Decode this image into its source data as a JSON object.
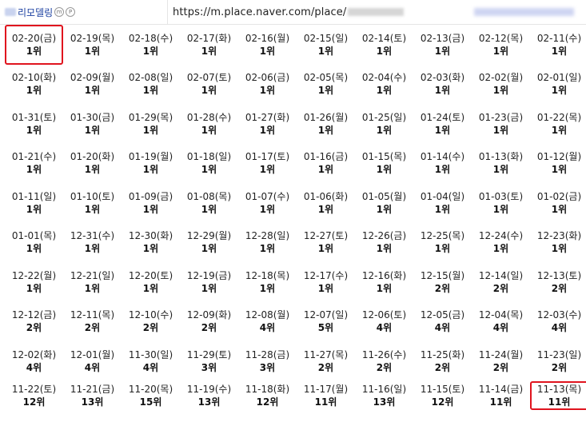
{
  "header": {
    "place_name": "리모델링",
    "place_suffix_icon": "mp-icon",
    "url": "https://m.place.naver.com/place/"
  },
  "highlight_color": "#e0141e",
  "cells": [
    {
      "date": "02-20(금)",
      "rank": "1위",
      "highlight": true
    },
    {
      "date": "02-19(목)",
      "rank": "1위"
    },
    {
      "date": "02-18(수)",
      "rank": "1위"
    },
    {
      "date": "02-17(화)",
      "rank": "1위"
    },
    {
      "date": "02-16(월)",
      "rank": "1위"
    },
    {
      "date": "02-15(일)",
      "rank": "1위"
    },
    {
      "date": "02-14(토)",
      "rank": "1위"
    },
    {
      "date": "02-13(금)",
      "rank": "1위"
    },
    {
      "date": "02-12(목)",
      "rank": "1위"
    },
    {
      "date": "02-11(수)",
      "rank": "1위"
    },
    {
      "date": "02-10(화)",
      "rank": "1위"
    },
    {
      "date": "02-09(월)",
      "rank": "1위"
    },
    {
      "date": "02-08(일)",
      "rank": "1위"
    },
    {
      "date": "02-07(토)",
      "rank": "1위"
    },
    {
      "date": "02-06(금)",
      "rank": "1위"
    },
    {
      "date": "02-05(목)",
      "rank": "1위"
    },
    {
      "date": "02-04(수)",
      "rank": "1위"
    },
    {
      "date": "02-03(화)",
      "rank": "1위"
    },
    {
      "date": "02-02(월)",
      "rank": "1위"
    },
    {
      "date": "02-01(일)",
      "rank": "1위"
    },
    {
      "date": "01-31(토)",
      "rank": "1위"
    },
    {
      "date": "01-30(금)",
      "rank": "1위"
    },
    {
      "date": "01-29(목)",
      "rank": "1위"
    },
    {
      "date": "01-28(수)",
      "rank": "1위"
    },
    {
      "date": "01-27(화)",
      "rank": "1위"
    },
    {
      "date": "01-26(월)",
      "rank": "1위"
    },
    {
      "date": "01-25(일)",
      "rank": "1위"
    },
    {
      "date": "01-24(토)",
      "rank": "1위"
    },
    {
      "date": "01-23(금)",
      "rank": "1위"
    },
    {
      "date": "01-22(목)",
      "rank": "1위"
    },
    {
      "date": "01-21(수)",
      "rank": "1위"
    },
    {
      "date": "01-20(화)",
      "rank": "1위"
    },
    {
      "date": "01-19(월)",
      "rank": "1위"
    },
    {
      "date": "01-18(일)",
      "rank": "1위"
    },
    {
      "date": "01-17(토)",
      "rank": "1위"
    },
    {
      "date": "01-16(금)",
      "rank": "1위"
    },
    {
      "date": "01-15(목)",
      "rank": "1위"
    },
    {
      "date": "01-14(수)",
      "rank": "1위"
    },
    {
      "date": "01-13(화)",
      "rank": "1위"
    },
    {
      "date": "01-12(월)",
      "rank": "1위"
    },
    {
      "date": "01-11(일)",
      "rank": "1위"
    },
    {
      "date": "01-10(토)",
      "rank": "1위"
    },
    {
      "date": "01-09(금)",
      "rank": "1위"
    },
    {
      "date": "01-08(목)",
      "rank": "1위"
    },
    {
      "date": "01-07(수)",
      "rank": "1위"
    },
    {
      "date": "01-06(화)",
      "rank": "1위"
    },
    {
      "date": "01-05(월)",
      "rank": "1위"
    },
    {
      "date": "01-04(일)",
      "rank": "1위"
    },
    {
      "date": "01-03(토)",
      "rank": "1위"
    },
    {
      "date": "01-02(금)",
      "rank": "1위"
    },
    {
      "date": "01-01(목)",
      "rank": "1위"
    },
    {
      "date": "12-31(수)",
      "rank": "1위"
    },
    {
      "date": "12-30(화)",
      "rank": "1위"
    },
    {
      "date": "12-29(월)",
      "rank": "1위"
    },
    {
      "date": "12-28(일)",
      "rank": "1위"
    },
    {
      "date": "12-27(토)",
      "rank": "1위"
    },
    {
      "date": "12-26(금)",
      "rank": "1위"
    },
    {
      "date": "12-25(목)",
      "rank": "1위"
    },
    {
      "date": "12-24(수)",
      "rank": "1위"
    },
    {
      "date": "12-23(화)",
      "rank": "1위"
    },
    {
      "date": "12-22(월)",
      "rank": "1위"
    },
    {
      "date": "12-21(일)",
      "rank": "1위"
    },
    {
      "date": "12-20(토)",
      "rank": "1위"
    },
    {
      "date": "12-19(금)",
      "rank": "1위"
    },
    {
      "date": "12-18(목)",
      "rank": "1위"
    },
    {
      "date": "12-17(수)",
      "rank": "1위"
    },
    {
      "date": "12-16(화)",
      "rank": "1위"
    },
    {
      "date": "12-15(월)",
      "rank": "2위"
    },
    {
      "date": "12-14(일)",
      "rank": "2위"
    },
    {
      "date": "12-13(토)",
      "rank": "2위"
    },
    {
      "date": "12-12(금)",
      "rank": "2위"
    },
    {
      "date": "12-11(목)",
      "rank": "2위"
    },
    {
      "date": "12-10(수)",
      "rank": "2위"
    },
    {
      "date": "12-09(화)",
      "rank": "2위"
    },
    {
      "date": "12-08(월)",
      "rank": "4위"
    },
    {
      "date": "12-07(일)",
      "rank": "5위"
    },
    {
      "date": "12-06(토)",
      "rank": "4위"
    },
    {
      "date": "12-05(금)",
      "rank": "4위"
    },
    {
      "date": "12-04(목)",
      "rank": "4위"
    },
    {
      "date": "12-03(수)",
      "rank": "4위"
    },
    {
      "date": "12-02(화)",
      "rank": "4위"
    },
    {
      "date": "12-01(월)",
      "rank": "4위"
    },
    {
      "date": "11-30(일)",
      "rank": "4위"
    },
    {
      "date": "11-29(토)",
      "rank": "3위"
    },
    {
      "date": "11-28(금)",
      "rank": "3위"
    },
    {
      "date": "11-27(목)",
      "rank": "2위"
    },
    {
      "date": "11-26(수)",
      "rank": "2위"
    },
    {
      "date": "11-25(화)",
      "rank": "2위"
    },
    {
      "date": "11-24(월)",
      "rank": "2위"
    },
    {
      "date": "11-23(일)",
      "rank": "2위"
    },
    {
      "date": "11-22(토)",
      "rank": "12위"
    },
    {
      "date": "11-21(금)",
      "rank": "13위"
    },
    {
      "date": "11-20(목)",
      "rank": "15위"
    },
    {
      "date": "11-19(수)",
      "rank": "13위"
    },
    {
      "date": "11-18(화)",
      "rank": "12위"
    },
    {
      "date": "11-17(월)",
      "rank": "11위"
    },
    {
      "date": "11-16(일)",
      "rank": "13위"
    },
    {
      "date": "11-15(토)",
      "rank": "12위"
    },
    {
      "date": "11-14(금)",
      "rank": "11위"
    },
    {
      "date": "11-13(목)",
      "rank": "11위",
      "highlight": true
    }
  ]
}
